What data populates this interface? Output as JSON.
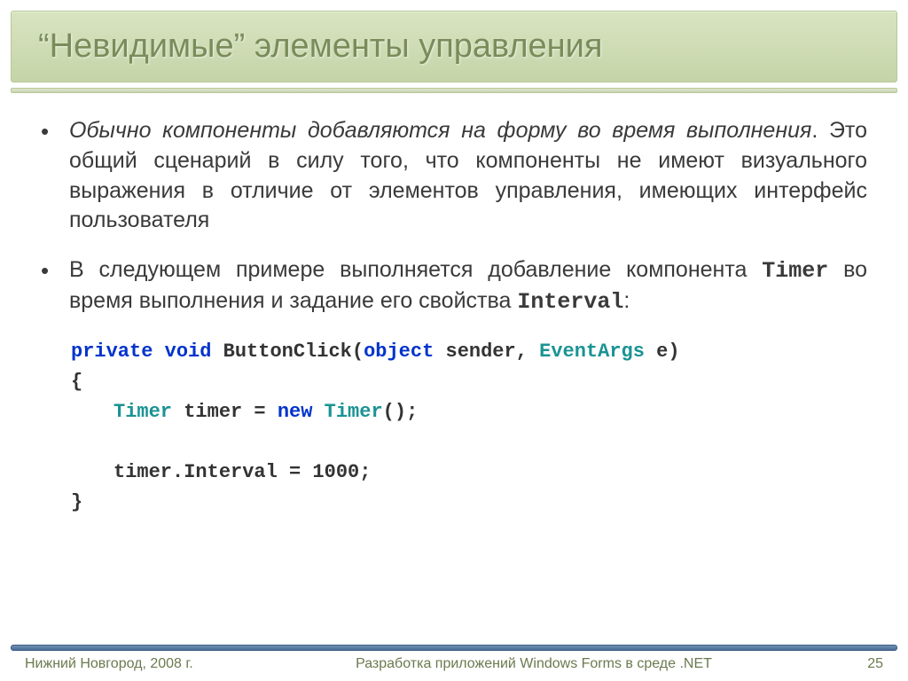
{
  "title": "“Невидимые” элементы управления",
  "bullets": {
    "b1_italic": "Обычно компоненты добавляются на форму во время выполнения",
    "b1_rest": ". Это общий сценарий в силу того, что компоненты не имеют визуального выражения в отличие от элементов управления, имеющих интерфейс пользователя",
    "b2_part1": "В следующем примере выполняется добавление компонента ",
    "b2_mono1": "Timer",
    "b2_part2": " во время выполнения и задание его свойства ",
    "b2_mono2": "Interval",
    "b2_part3": ":"
  },
  "code": {
    "kw_private": "private",
    "kw_void": "void",
    "fn_name": " ButtonClick(",
    "kw_object": "object",
    "arg_sender": " sender, ",
    "type_eventargs": "EventArgs",
    "arg_e": " e)",
    "brace_open": "{",
    "type_timer1": "Timer",
    "var_timer": " timer = ",
    "kw_new": "new",
    "space": " ",
    "type_timer2": "Timer",
    "ctor_end": "();",
    "interval_line": "timer.Interval = 1000;",
    "brace_close": "}"
  },
  "footer": {
    "left": "Нижний Новгород, 2008 г.",
    "center": "Разработка приложений Windows Forms в среде .NET",
    "right": "25"
  }
}
